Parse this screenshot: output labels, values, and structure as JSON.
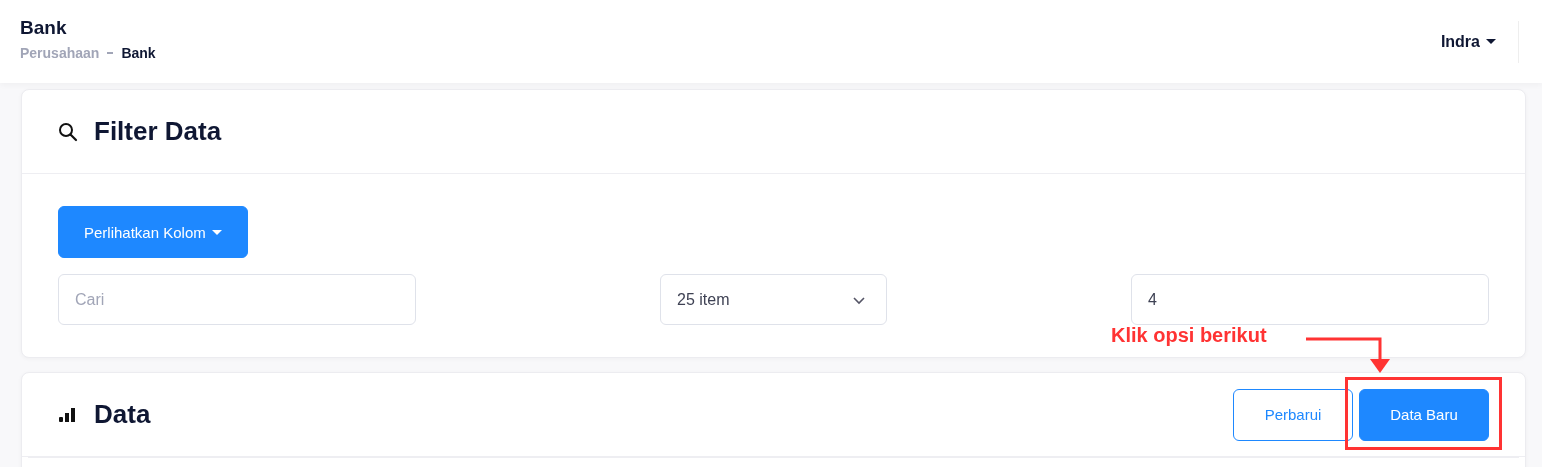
{
  "header": {
    "title": "Bank",
    "breadcrumb": [
      {
        "label": "Perusahaan",
        "current": false
      },
      {
        "label": "Bank",
        "current": true
      }
    ],
    "user": "Indra"
  },
  "filter": {
    "title": "Filter Data",
    "columns_button": "Perlihatkan Kolom",
    "search": {
      "placeholder": "Cari"
    },
    "page_size": {
      "value": "25 item"
    },
    "page": {
      "value": "4"
    }
  },
  "data": {
    "title": "Data",
    "buttons": [
      {
        "label": "Perbarui",
        "kind": "outline"
      },
      {
        "label": "Data Baru",
        "kind": "primary"
      }
    ]
  },
  "annotation": {
    "text": "Klik opsi berikut"
  }
}
